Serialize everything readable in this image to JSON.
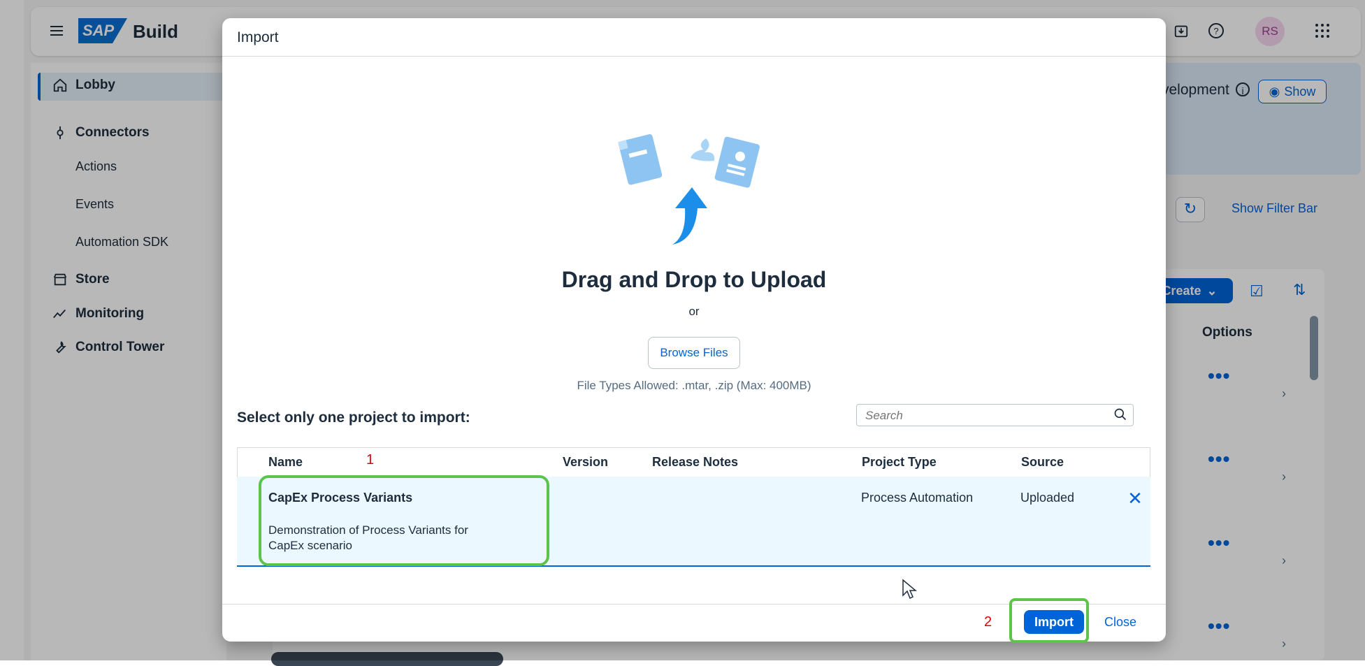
{
  "shell": {
    "logo_text": "SAP",
    "product_name": "Build",
    "avatar_initials": "RS",
    "icons": [
      "menu-icon",
      "download-icon",
      "help-icon",
      "grid-apps-icon"
    ]
  },
  "sidebar": {
    "items": [
      {
        "label": "Lobby",
        "icon": "home-icon",
        "active": true
      },
      {
        "label": "Connectors",
        "icon": "connector-icon"
      },
      {
        "label": "Actions"
      },
      {
        "label": "Events"
      },
      {
        "label": "Automation SDK"
      },
      {
        "label": "Store",
        "icon": "store-icon"
      },
      {
        "label": "Monitoring",
        "icon": "monitoring-icon"
      },
      {
        "label": "Control Tower",
        "icon": "wrench-icon"
      }
    ]
  },
  "background": {
    "banner_text": "velopment",
    "show_label": "Show",
    "show_filter_bar": "Show Filter Bar",
    "create_label": "Create",
    "options_header": "Options"
  },
  "dialog": {
    "title": "Import",
    "drop_title": "Drag and Drop to Upload",
    "or_text": "or",
    "browse_label": "Browse Files",
    "file_types": "File Types Allowed: .mtar, .zip  (Max: 400MB)",
    "select_label": "Select only one project to import:",
    "search_placeholder": "Search",
    "columns": [
      "Name",
      "Version",
      "Release Notes",
      "Project Type",
      "Source"
    ],
    "rows": [
      {
        "name": "CapEx Process Variants",
        "description": "Demonstration of Process Variants for CapEx scenario",
        "version": "",
        "release_notes": "",
        "project_type": "Process Automation",
        "source": "Uploaded"
      }
    ],
    "import_label": "Import",
    "close_label": "Close"
  },
  "annotations": {
    "step1": "1",
    "step2": "2",
    "highlight_color": "#5dc34a",
    "number_color": "#e00000"
  },
  "colors": {
    "accent": "#0064d9",
    "selected_row": "#ebf8ff"
  }
}
